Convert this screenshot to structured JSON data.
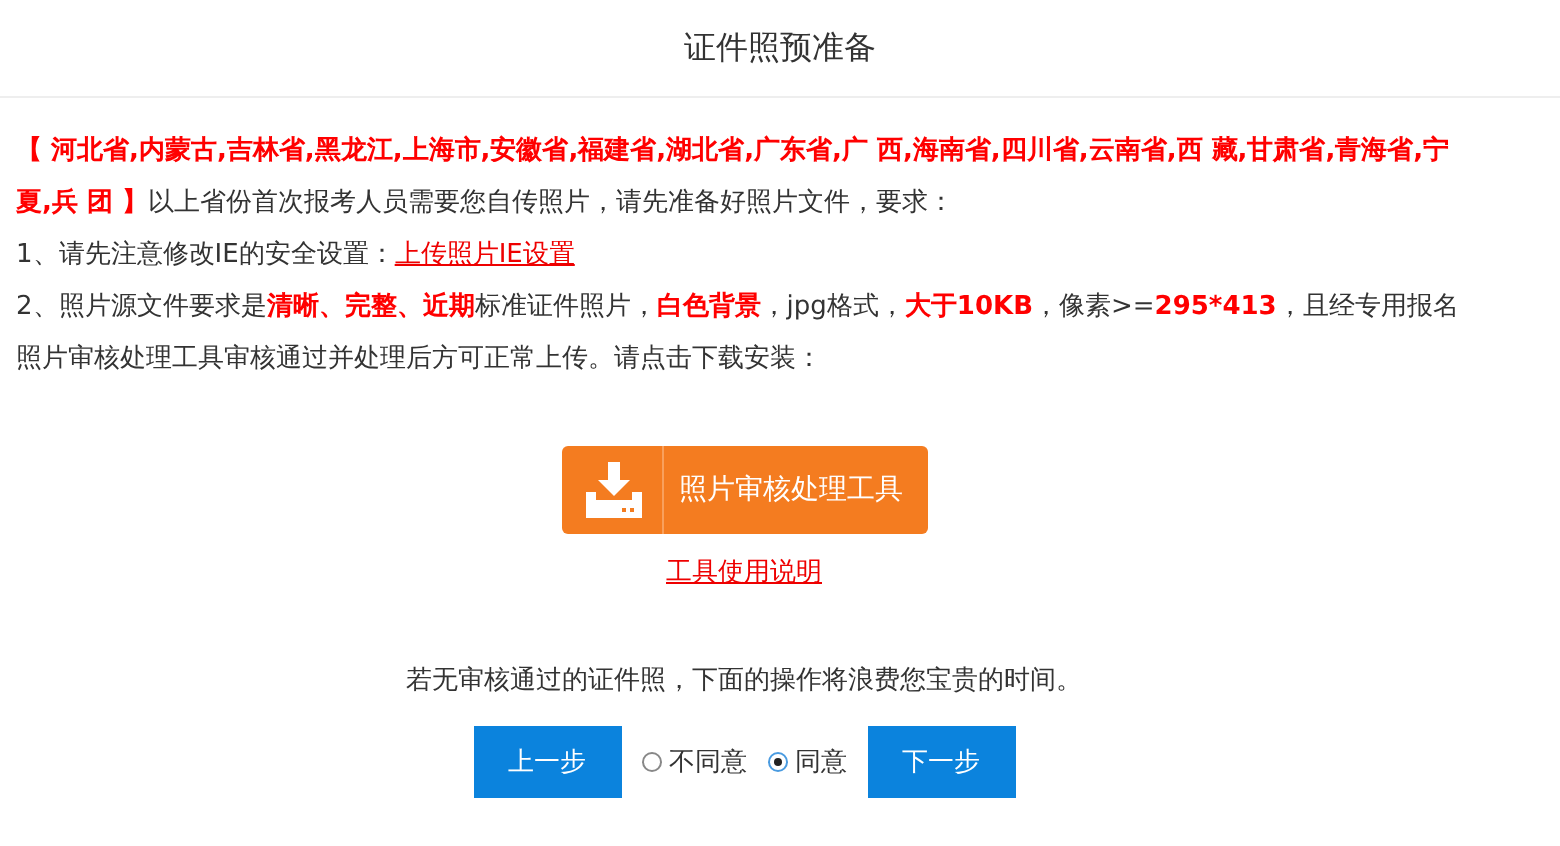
{
  "title": "证件照预准备",
  "intro": "**【 河北省,内蒙古,吉林省,黑龙江,上海市,安徽省,福建省,湖北省,广东省,广 西,海南省,四川省,云南省,西 藏,甘肃省,青海省,宁夏,兵 团 】**以上省份首次报考人员需要您自传照片，请先准备好照片文件，要求：",
  "step1": {
    "text": "1、请先注意修改IE的安全设置：",
    "link": "上传照片IE设置"
  },
  "step2": "2、照片源文件要求是**清晰、完整、近期**标准证件照片，**白色背景**，jpg格式，**大于10KB**，像素>=**295*413**，且经专用报名照片审核处理工具审核通过并处理后方可正常上传。请点击下载安装：",
  "download_button": "照片审核处理工具",
  "help_link": "工具使用说明",
  "warning": "若无审核通过的证件照，下面的操作将浪费您宝贵的时间。",
  "prev_button": "上一步",
  "options": [
    {
      "label": "不同意",
      "selected": false
    },
    {
      "label": "同意",
      "selected": true
    }
  ],
  "next_button": "下一步"
}
